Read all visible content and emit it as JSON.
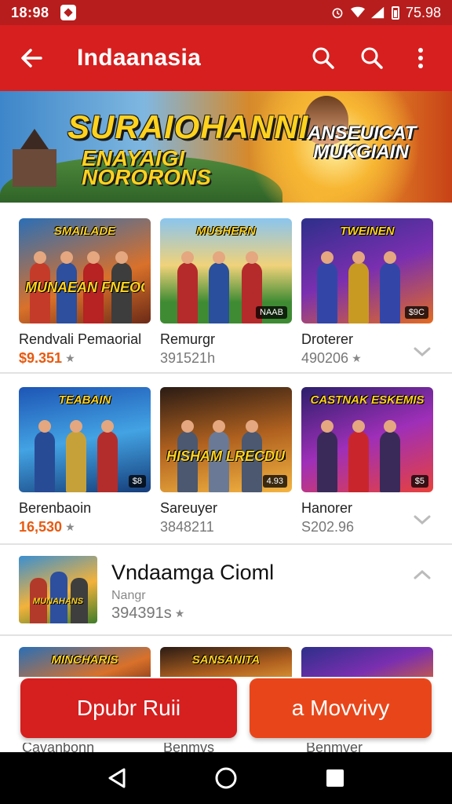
{
  "status_bar": {
    "time": "18:98",
    "battery": "75.98"
  },
  "app_bar": {
    "title": "Indaanasia"
  },
  "banner": {
    "title": "SURAIOHANNI",
    "subtitle_line1": "ENAYAIGI",
    "subtitle_line2": "NORORONS",
    "tag": "ANSEUICAT MUKGIAIN"
  },
  "games": [
    {
      "name": "Rendvali Pemaorial",
      "meta": "$9.351",
      "art_top": "SMAILADE",
      "art_mid": "MUNAEAN FNEOGES",
      "badge": ""
    },
    {
      "name": "Remurgr",
      "meta": "391521h",
      "art_top": "MUSHERN",
      "art_mid": "",
      "badge": "NAAB"
    },
    {
      "name": "Droterer",
      "meta": "490206",
      "art_top": "TWEINEN",
      "art_mid": "",
      "badge": "$9C"
    },
    {
      "name": "Berenbaoin",
      "meta": "16,530",
      "art_top": "TEABAIN",
      "art_mid": "",
      "badge": "$8"
    },
    {
      "name": "Sareuyer",
      "meta": "3848211",
      "art_top": "",
      "art_mid": "HISHAM LRECDUEN",
      "badge": "4.93"
    },
    {
      "name": "Hanorer",
      "meta": "S202.96",
      "art_top": "CASTNAK ESKEMIS",
      "art_mid": "",
      "badge": "$5"
    }
  ],
  "featured": {
    "title": "Vndaamga Cioml",
    "subtitle": "Nangr",
    "meta": "394391s",
    "art_label": "MUNAHANS"
  },
  "partial_cards": [
    {
      "art_label": "MINCHARIS"
    },
    {
      "art_label": "SANSANITA"
    },
    {
      "art_label": ""
    }
  ],
  "peek_labels": [
    "Cavanbonn",
    "Benmvs",
    "Benmver"
  ],
  "actions": {
    "primary_label": "Dpubr Ruii",
    "secondary_label": "a Movvivy"
  },
  "colors": {
    "brand_red": "#d71f1f",
    "status_red": "#b71d1d",
    "accent_orange": "#e8461a",
    "price_orange": "#e85a10"
  },
  "icons": {
    "back": "arrow-left-icon",
    "search1": "search-icon",
    "search2": "search-icon",
    "more": "more-vert-icon"
  }
}
